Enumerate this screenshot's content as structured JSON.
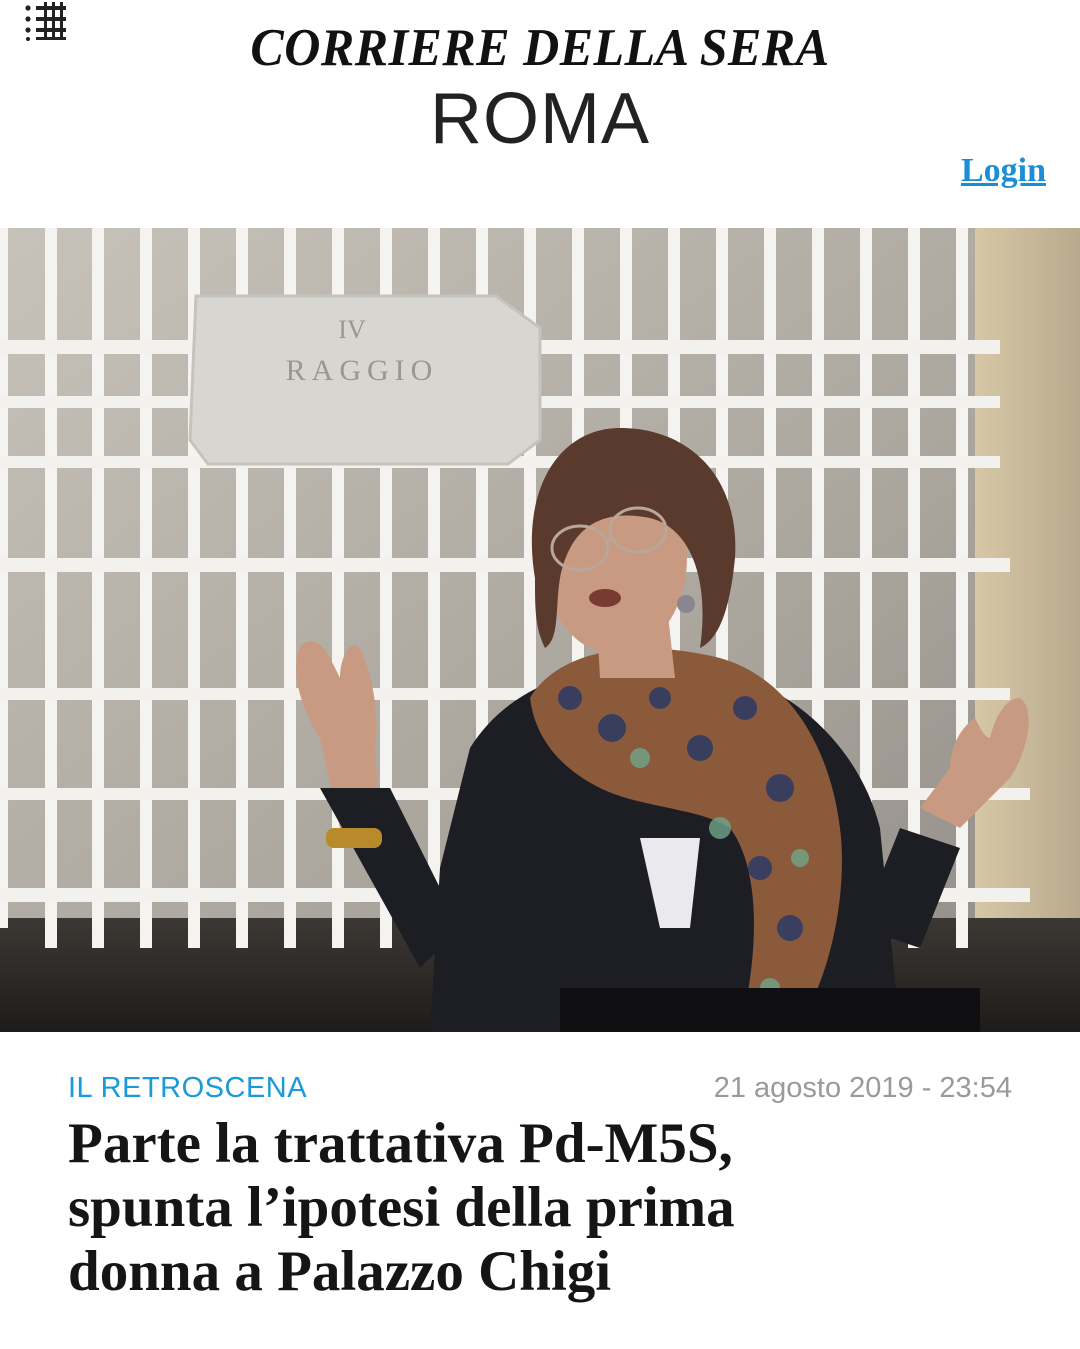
{
  "header": {
    "masthead": "CORRIERE DELLA SERA",
    "section": "ROMA",
    "login_label": "Login",
    "menu_icon": "list-menu-icon"
  },
  "hero_image": {
    "sign_text_top": "IV",
    "sign_text": "RAGGIO"
  },
  "article": {
    "kicker": "IL RETROSCENA",
    "date": "21 agosto 2019 - 23:54",
    "headline_lines": [
      "Parte la trattativa Pd-M5S,",
      "spunta l’ipotesi della prima",
      "donna a Palazzo Chigi"
    ]
  },
  "colors": {
    "accent": "#1a9ad9",
    "link": "#1a8fd6",
    "text": "#151515",
    "muted": "#9a9a9a"
  }
}
